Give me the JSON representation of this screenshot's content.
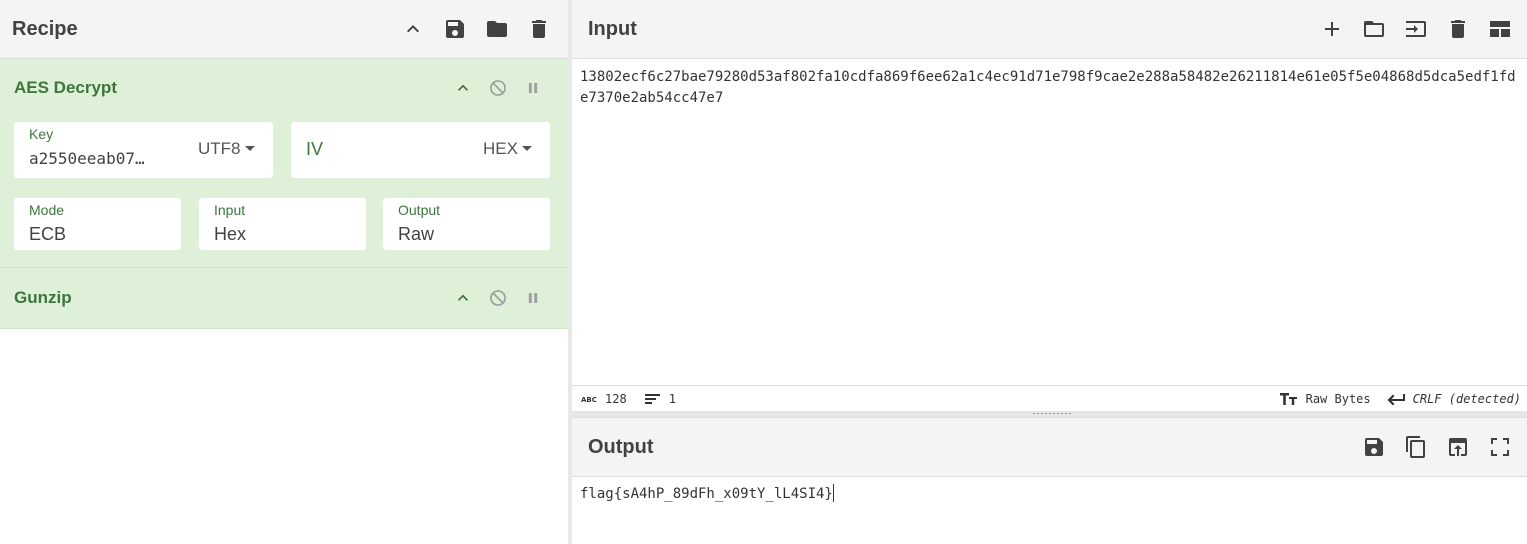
{
  "recipe": {
    "title": "Recipe",
    "operations": [
      {
        "name": "AES Decrypt",
        "key": {
          "label": "Key",
          "value": "a2550eeab07…",
          "encoding": "UTF8"
        },
        "iv": {
          "placeholder": "IV",
          "encoding": "HEX"
        },
        "mode": {
          "label": "Mode",
          "value": "ECB"
        },
        "input": {
          "label": "Input",
          "value": "Hex"
        },
        "output": {
          "label": "Output",
          "value": "Raw"
        }
      },
      {
        "name": "Gunzip"
      }
    ]
  },
  "input": {
    "title": "Input",
    "text": "13802ecf6c27bae79280d53af802fa10cdfa869f6ee62a1c4ec91d71e798f9cae2e288a58482e26211814e61e05f5e04868d5dca5edf1fde7370e2ab54cc47e7",
    "status": {
      "chars": "128",
      "lines": "1",
      "encoding": "Raw Bytes",
      "eol": "CRLF (detected)"
    }
  },
  "output": {
    "title": "Output",
    "text": "flag{sA4hP_89dFh_x09tY_lL4SI4}"
  },
  "colors": {
    "op_bg": "#dff0d8",
    "op_text": "#3c763d",
    "header_bg": "#f4f4f4"
  }
}
